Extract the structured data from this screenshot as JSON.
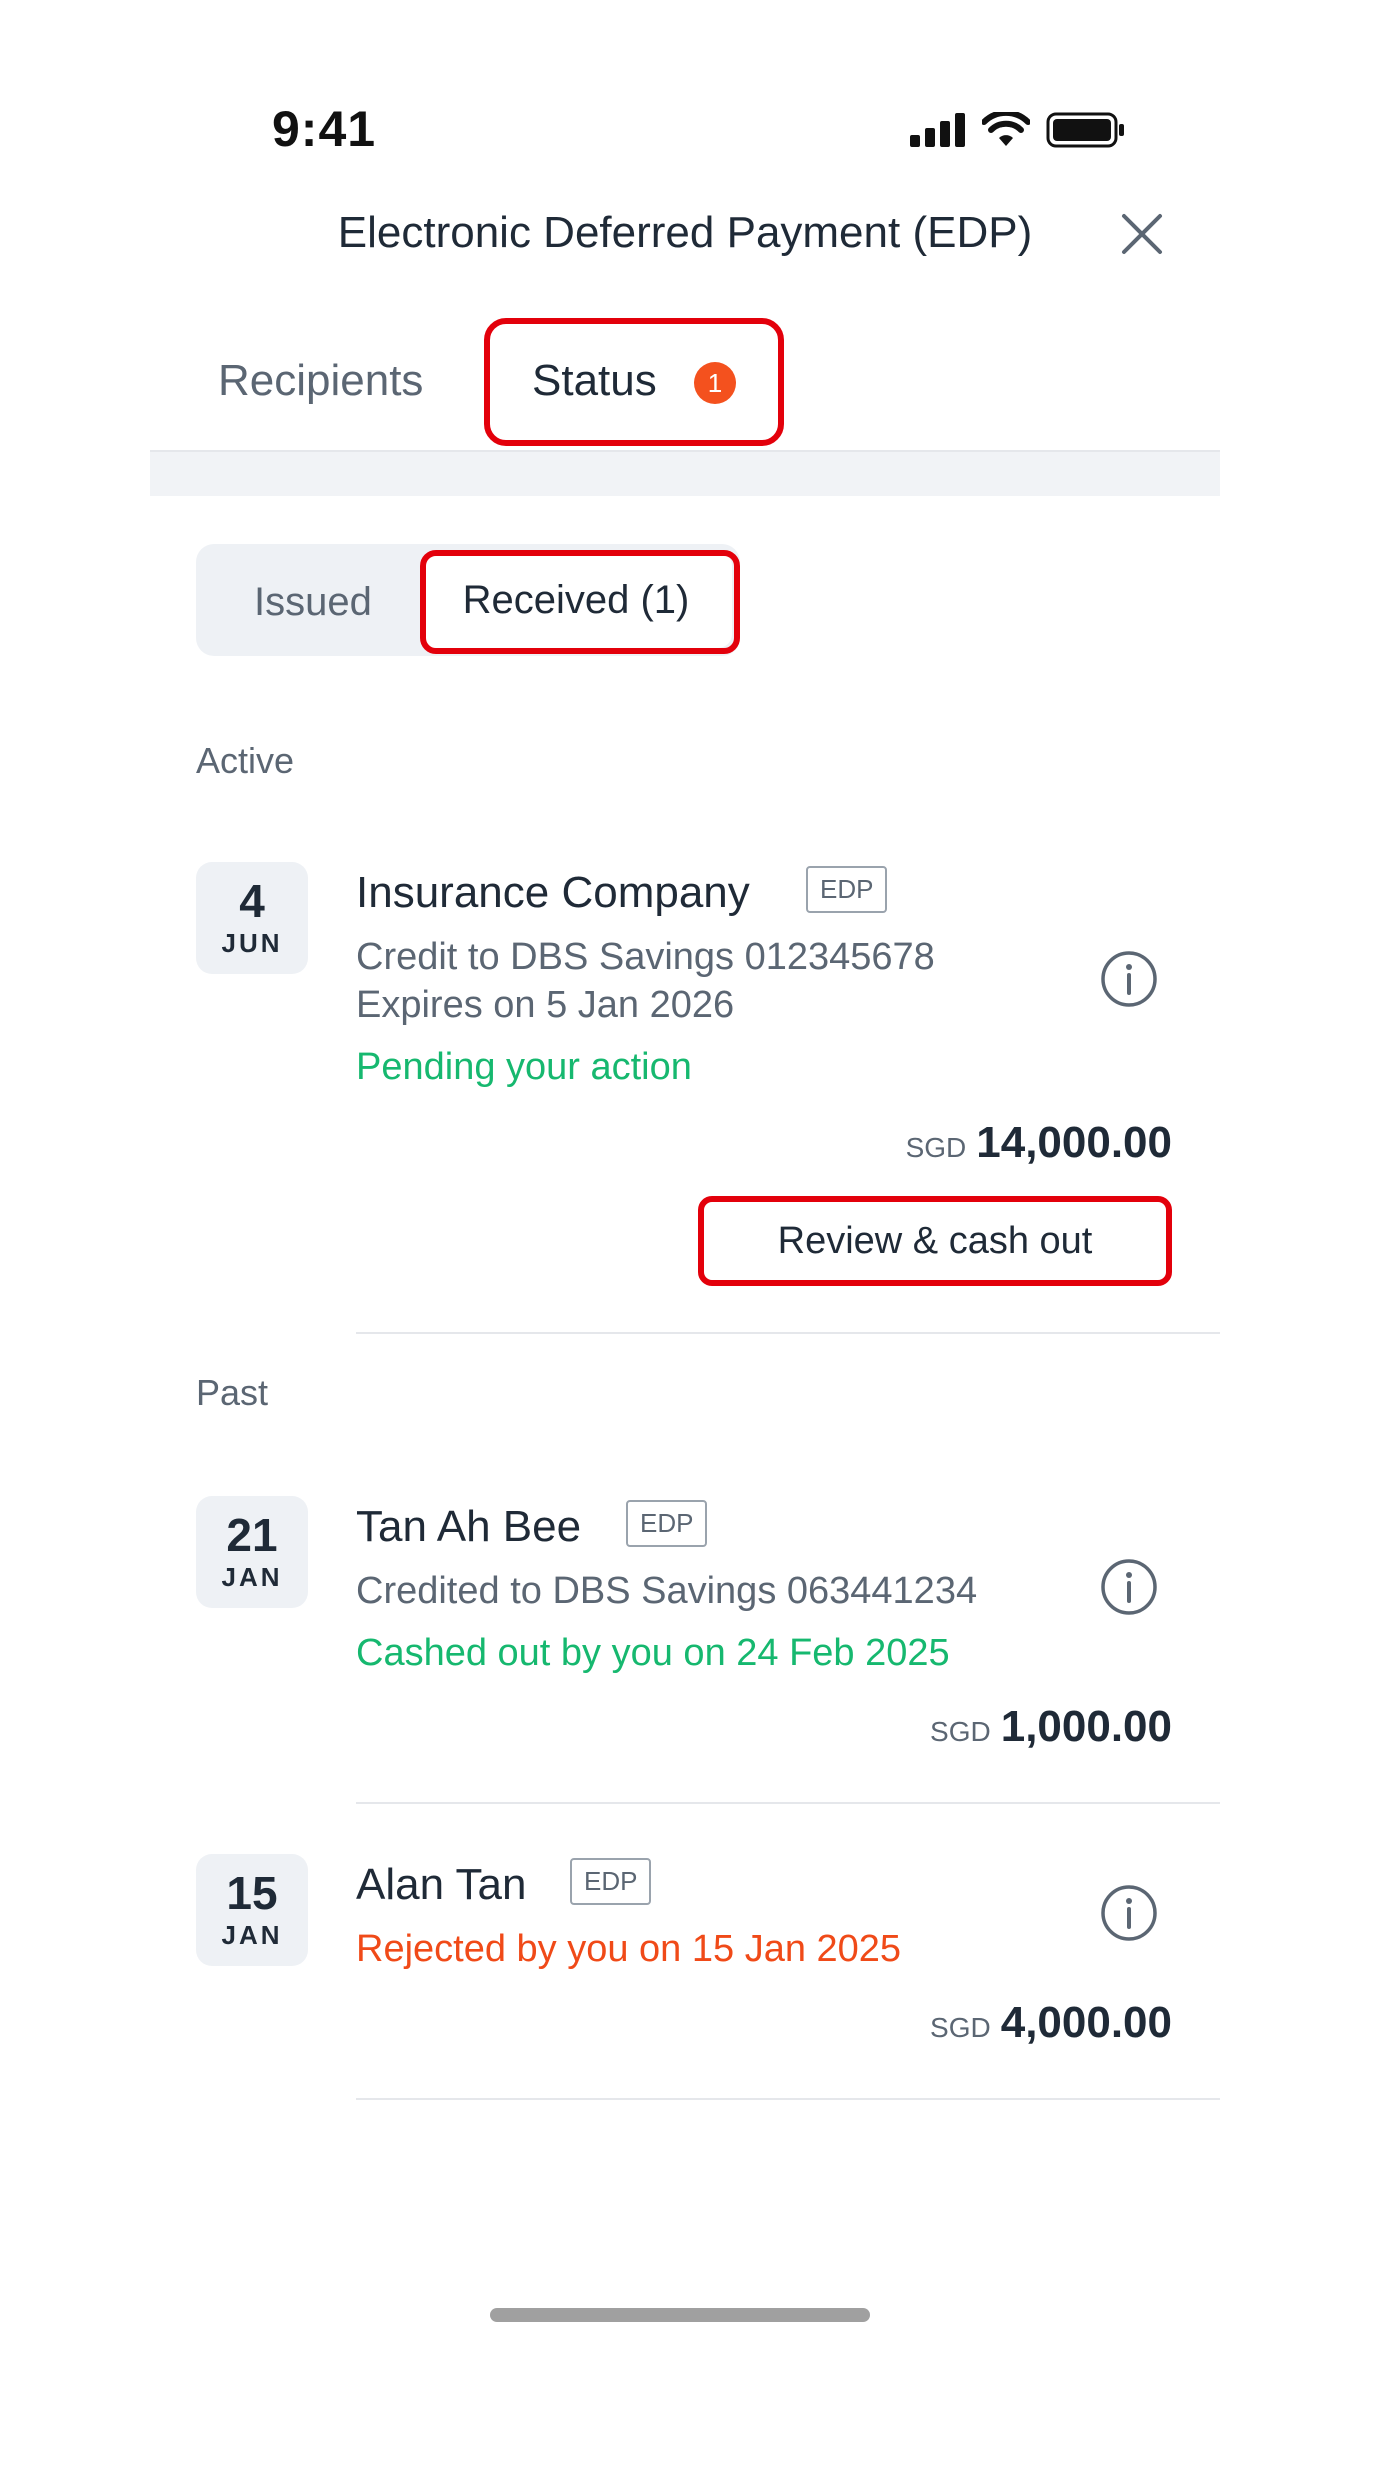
{
  "status_bar": {
    "time": "9:41"
  },
  "header": {
    "title": "Electronic Deferred Payment (EDP)"
  },
  "tabs": [
    {
      "label": "Recipients"
    },
    {
      "label": "Status",
      "badge": "1"
    }
  ],
  "segment": {
    "issued": "Issued",
    "received": "Received (1)"
  },
  "sections": {
    "active": "Active",
    "past": "Past"
  },
  "tag": "EDP",
  "items": [
    {
      "day": "4",
      "month": "JUN",
      "name": "Insurance Company",
      "line1": "Credit to DBS Savings 012345678",
      "line2": "Expires on 5 Jan 2026",
      "status": "Pending your action",
      "currency": "SGD",
      "amount": "14,000.00",
      "action": "Review & cash out"
    },
    {
      "day": "21",
      "month": "JAN",
      "name": "Tan Ah Bee",
      "line1": "Credited to DBS Savings 063441234",
      "status": "Cashed out by you on 24 Feb 2025",
      "currency": "SGD",
      "amount": "1,000.00"
    },
    {
      "day": "15",
      "month": "JAN",
      "name": "Alan Tan",
      "status": "Rejected by you on 15 Jan 2025",
      "currency": "SGD",
      "amount": "4,000.00"
    }
  ],
  "colors": {
    "accent_green": "#16b86f",
    "accent_red": "#f04a18",
    "highlight": "#e3000b",
    "badge": "#f4511e"
  }
}
